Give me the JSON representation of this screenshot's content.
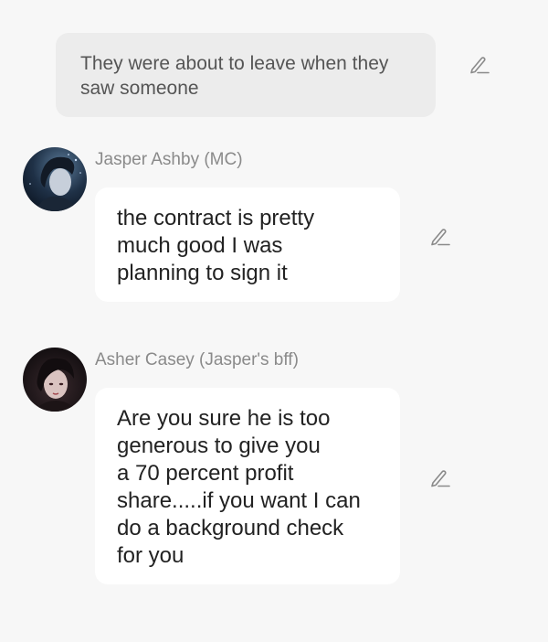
{
  "narration": {
    "lines": [
      "They were about to leave when they",
      "saw someone"
    ]
  },
  "messages": [
    {
      "speaker": "Jasper Ashby (MC)",
      "lines": [
        "the contract is pretty",
        "much good I was",
        "planning to sign it"
      ]
    },
    {
      "speaker": "Asher Casey (Jasper's bff)",
      "lines": [
        "Are you sure he is too",
        "generous to give you",
        "a 70 percent profit",
        "share.....if you want I can",
        "do a background check",
        "for you"
      ]
    }
  ],
  "icons": {
    "edit": "pencil-edit-icon",
    "icon_color": "#8a8a8a"
  },
  "colors": {
    "background": "#f7f7f7",
    "narration_bubble": "#ececec",
    "message_bubble": "#ffffff"
  }
}
